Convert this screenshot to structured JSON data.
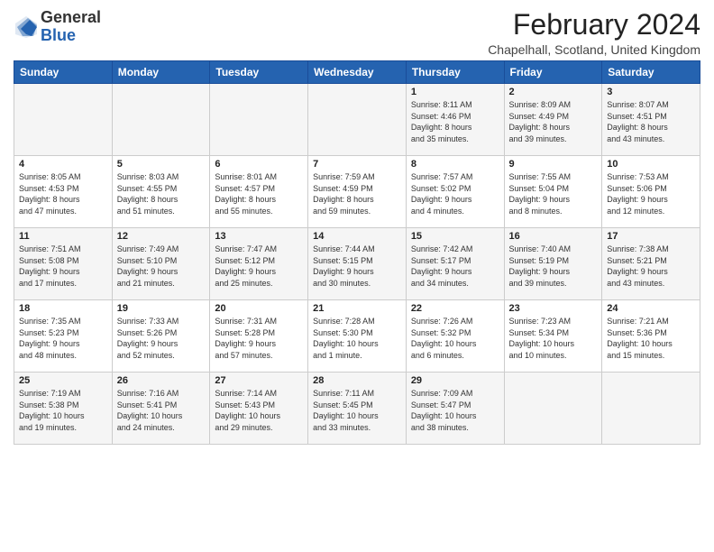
{
  "header": {
    "logo_line1": "General",
    "logo_line2": "Blue",
    "month_title": "February 2024",
    "location": "Chapelhall, Scotland, United Kingdom"
  },
  "weekdays": [
    "Sunday",
    "Monday",
    "Tuesday",
    "Wednesday",
    "Thursday",
    "Friday",
    "Saturday"
  ],
  "weeks": [
    [
      {
        "day": "",
        "info": ""
      },
      {
        "day": "",
        "info": ""
      },
      {
        "day": "",
        "info": ""
      },
      {
        "day": "",
        "info": ""
      },
      {
        "day": "1",
        "info": "Sunrise: 8:11 AM\nSunset: 4:46 PM\nDaylight: 8 hours\nand 35 minutes."
      },
      {
        "day": "2",
        "info": "Sunrise: 8:09 AM\nSunset: 4:49 PM\nDaylight: 8 hours\nand 39 minutes."
      },
      {
        "day": "3",
        "info": "Sunrise: 8:07 AM\nSunset: 4:51 PM\nDaylight: 8 hours\nand 43 minutes."
      }
    ],
    [
      {
        "day": "4",
        "info": "Sunrise: 8:05 AM\nSunset: 4:53 PM\nDaylight: 8 hours\nand 47 minutes."
      },
      {
        "day": "5",
        "info": "Sunrise: 8:03 AM\nSunset: 4:55 PM\nDaylight: 8 hours\nand 51 minutes."
      },
      {
        "day": "6",
        "info": "Sunrise: 8:01 AM\nSunset: 4:57 PM\nDaylight: 8 hours\nand 55 minutes."
      },
      {
        "day": "7",
        "info": "Sunrise: 7:59 AM\nSunset: 4:59 PM\nDaylight: 8 hours\nand 59 minutes."
      },
      {
        "day": "8",
        "info": "Sunrise: 7:57 AM\nSunset: 5:02 PM\nDaylight: 9 hours\nand 4 minutes."
      },
      {
        "day": "9",
        "info": "Sunrise: 7:55 AM\nSunset: 5:04 PM\nDaylight: 9 hours\nand 8 minutes."
      },
      {
        "day": "10",
        "info": "Sunrise: 7:53 AM\nSunset: 5:06 PM\nDaylight: 9 hours\nand 12 minutes."
      }
    ],
    [
      {
        "day": "11",
        "info": "Sunrise: 7:51 AM\nSunset: 5:08 PM\nDaylight: 9 hours\nand 17 minutes."
      },
      {
        "day": "12",
        "info": "Sunrise: 7:49 AM\nSunset: 5:10 PM\nDaylight: 9 hours\nand 21 minutes."
      },
      {
        "day": "13",
        "info": "Sunrise: 7:47 AM\nSunset: 5:12 PM\nDaylight: 9 hours\nand 25 minutes."
      },
      {
        "day": "14",
        "info": "Sunrise: 7:44 AM\nSunset: 5:15 PM\nDaylight: 9 hours\nand 30 minutes."
      },
      {
        "day": "15",
        "info": "Sunrise: 7:42 AM\nSunset: 5:17 PM\nDaylight: 9 hours\nand 34 minutes."
      },
      {
        "day": "16",
        "info": "Sunrise: 7:40 AM\nSunset: 5:19 PM\nDaylight: 9 hours\nand 39 minutes."
      },
      {
        "day": "17",
        "info": "Sunrise: 7:38 AM\nSunset: 5:21 PM\nDaylight: 9 hours\nand 43 minutes."
      }
    ],
    [
      {
        "day": "18",
        "info": "Sunrise: 7:35 AM\nSunset: 5:23 PM\nDaylight: 9 hours\nand 48 minutes."
      },
      {
        "day": "19",
        "info": "Sunrise: 7:33 AM\nSunset: 5:26 PM\nDaylight: 9 hours\nand 52 minutes."
      },
      {
        "day": "20",
        "info": "Sunrise: 7:31 AM\nSunset: 5:28 PM\nDaylight: 9 hours\nand 57 minutes."
      },
      {
        "day": "21",
        "info": "Sunrise: 7:28 AM\nSunset: 5:30 PM\nDaylight: 10 hours\nand 1 minute."
      },
      {
        "day": "22",
        "info": "Sunrise: 7:26 AM\nSunset: 5:32 PM\nDaylight: 10 hours\nand 6 minutes."
      },
      {
        "day": "23",
        "info": "Sunrise: 7:23 AM\nSunset: 5:34 PM\nDaylight: 10 hours\nand 10 minutes."
      },
      {
        "day": "24",
        "info": "Sunrise: 7:21 AM\nSunset: 5:36 PM\nDaylight: 10 hours\nand 15 minutes."
      }
    ],
    [
      {
        "day": "25",
        "info": "Sunrise: 7:19 AM\nSunset: 5:38 PM\nDaylight: 10 hours\nand 19 minutes."
      },
      {
        "day": "26",
        "info": "Sunrise: 7:16 AM\nSunset: 5:41 PM\nDaylight: 10 hours\nand 24 minutes."
      },
      {
        "day": "27",
        "info": "Sunrise: 7:14 AM\nSunset: 5:43 PM\nDaylight: 10 hours\nand 29 minutes."
      },
      {
        "day": "28",
        "info": "Sunrise: 7:11 AM\nSunset: 5:45 PM\nDaylight: 10 hours\nand 33 minutes."
      },
      {
        "day": "29",
        "info": "Sunrise: 7:09 AM\nSunset: 5:47 PM\nDaylight: 10 hours\nand 38 minutes."
      },
      {
        "day": "",
        "info": ""
      },
      {
        "day": "",
        "info": ""
      }
    ]
  ]
}
